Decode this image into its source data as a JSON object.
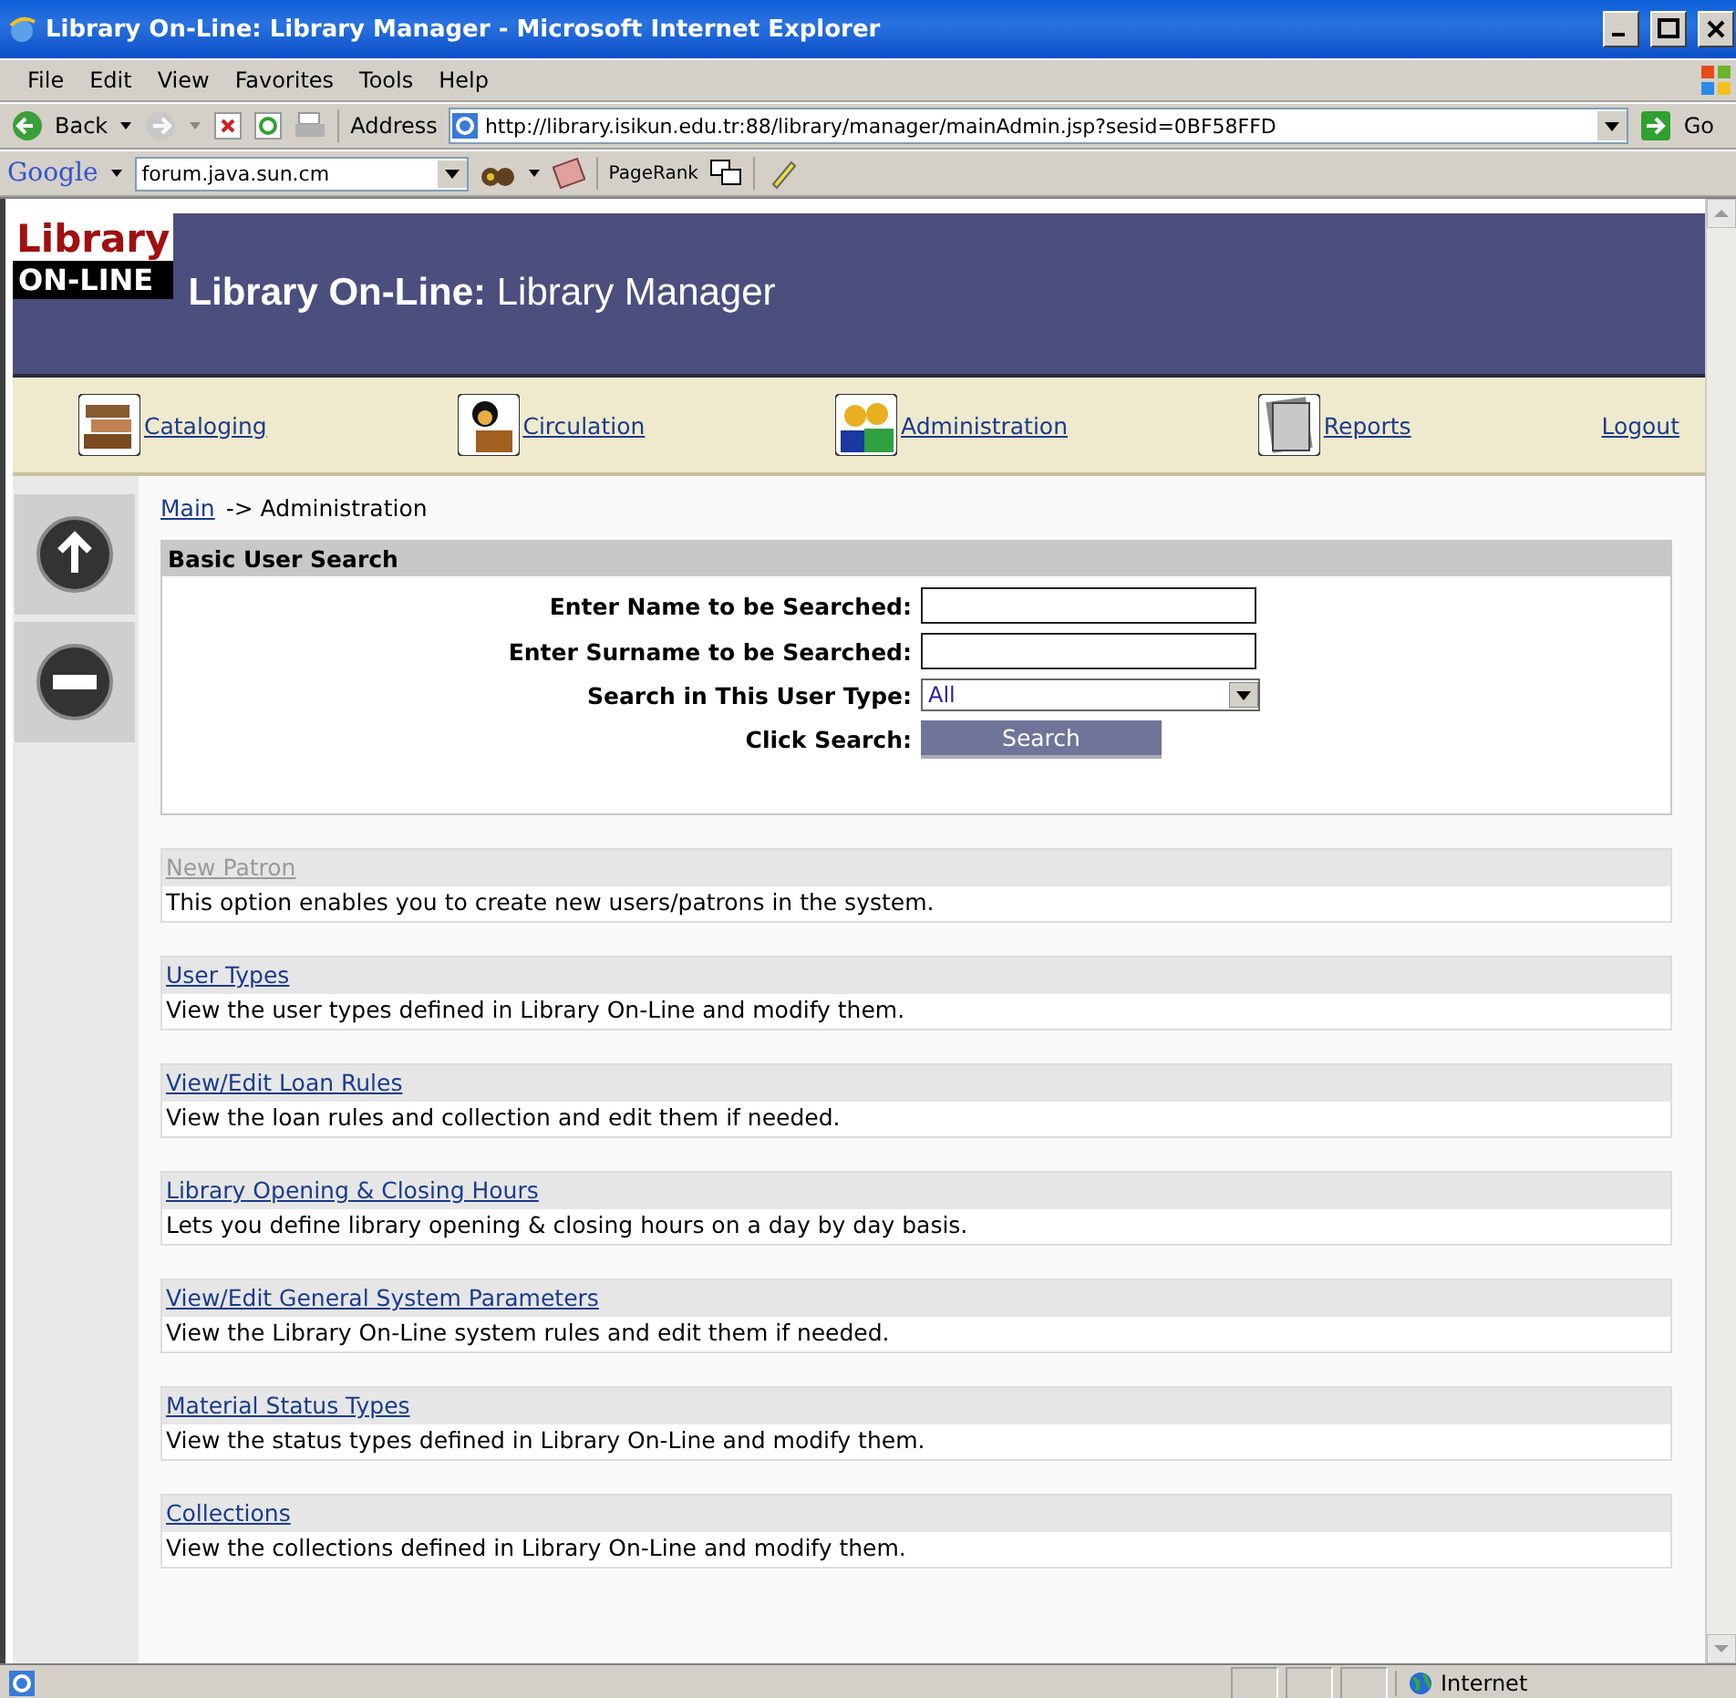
{
  "window": {
    "title": "Library On-Line: Library Manager - Microsoft Internet Explorer"
  },
  "menu": [
    "File",
    "Edit",
    "View",
    "Favorites",
    "Tools",
    "Help"
  ],
  "toolbar": {
    "back": "Back",
    "address_label": "Address",
    "address": "http://library.isikun.edu.tr:88/library/manager/mainAdmin.jsp?sesid=0BF58FFD",
    "go": "Go"
  },
  "google_bar": {
    "logo": "Google",
    "search": "forum.java.sun.cm",
    "pagerank": "PageRank"
  },
  "header": {
    "logo_top": "Library",
    "logo_bottom": "ON-LINE",
    "title_bold": "Library On-Line:",
    "title": "Library Manager"
  },
  "nav": [
    {
      "label": "Cataloging",
      "kind": "books"
    },
    {
      "label": "Circulation",
      "kind": "reader"
    },
    {
      "label": "Administration",
      "kind": "people"
    },
    {
      "label": "Reports",
      "kind": "papers"
    },
    {
      "label": "Logout",
      "kind": "plain"
    }
  ],
  "breadcrumb": {
    "link": "Main",
    "rest": "-> Administration"
  },
  "search_panel": {
    "title": "Basic User Search",
    "fields": [
      {
        "kind": "text",
        "label": "Enter Name to be Searched:"
      },
      {
        "kind": "text",
        "label": "Enter Surname to be Searched:"
      },
      {
        "kind": "select",
        "label": "Search in This User Type:",
        "value": "All"
      },
      {
        "kind": "button",
        "label": "Click Search:",
        "value": "Search"
      }
    ]
  },
  "options": [
    {
      "link": "New Patron",
      "disabled": true,
      "description": "This option enables you to create new users/patrons in the system."
    },
    {
      "link": "User Types",
      "disabled": false,
      "description": "View the user types defined in Library On-Line and modify them."
    },
    {
      "link": "View/Edit Loan Rules",
      "disabled": false,
      "description": "View the loan rules and collection and edit them if needed."
    },
    {
      "link": "Library Opening & Closing Hours",
      "disabled": false,
      "description": "Lets you define library opening & closing hours on a day by day basis."
    },
    {
      "link": "View/Edit General System Parameters",
      "disabled": false,
      "description": "View the Library On-Line system rules and edit them if needed."
    },
    {
      "link": "Material Status Types",
      "disabled": false,
      "description": "View the status types defined in Library On-Line and modify them."
    },
    {
      "link": "Collections",
      "disabled": false,
      "description": "View the collections defined in Library On-Line and modify them."
    }
  ],
  "status_bar": {
    "zone": "Internet"
  }
}
